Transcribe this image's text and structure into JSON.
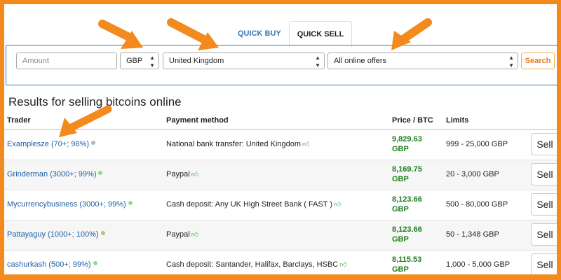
{
  "tabs": {
    "buy_label": "QUICK BUY",
    "sell_label": "QUICK SELL"
  },
  "search": {
    "amount_placeholder": "Amount",
    "currency": "GBP",
    "country": "United Kingdom",
    "offers": "All online offers",
    "search_label": "Search"
  },
  "results_title": "Results for selling bitcoins online",
  "table": {
    "headers": {
      "trader": "Trader",
      "payment": "Payment method",
      "price": "Price / BTC",
      "limits": "Limits"
    },
    "rows": [
      {
        "trader": "Examplesze (70+; 98%)",
        "status": "gray",
        "payment": "National bank transfer: United Kingdom",
        "price_value": "9,829.63",
        "price_currency": "GBP",
        "limits": "999 - 25,000 GBP",
        "action": "Sell"
      },
      {
        "trader": "Grinderman (3000+; 99%)",
        "status": "green",
        "payment": "Paypal",
        "price_value": "8,169.75",
        "price_currency": "GBP",
        "limits": "20 - 3,000 GBP",
        "action": "Sell"
      },
      {
        "trader": "Mycurrencybusiness (3000+; 99%)",
        "status": "green",
        "payment": "Cash deposit: Any UK High Street Bank ( FAST )",
        "price_value": "8,123.66",
        "price_currency": "GBP",
        "limits": "500 - 80,000 GBP",
        "action": "Sell"
      },
      {
        "trader": "Pattayaguy (1000+; 100%)",
        "status": "olive",
        "payment": "Paypal",
        "price_value": "8,123.66",
        "price_currency": "GBP",
        "limits": "50 - 1,348 GBP",
        "action": "Sell"
      },
      {
        "trader": "cashurkash (500+; 99%)",
        "status": "green",
        "payment": "Cash deposit: Santander, Halifax, Barclays, HSBC",
        "price_value": "8,115.53",
        "price_currency": "GBP",
        "limits": "1,000 - 5,000 GBP",
        "action": "Sell"
      }
    ]
  },
  "colors": {
    "annotation": "#f28a1e",
    "link": "#1f5fa6",
    "price": "#1e7d1e",
    "status_green": "#8fdc8f",
    "status_gray": "#b5b5b5",
    "status_olive": "#c2b98a"
  },
  "icons": {
    "thumbs_up": "thumbs-up-icon",
    "select_arrows": "select-arrows-icon",
    "status_dot": "status-dot-icon"
  }
}
